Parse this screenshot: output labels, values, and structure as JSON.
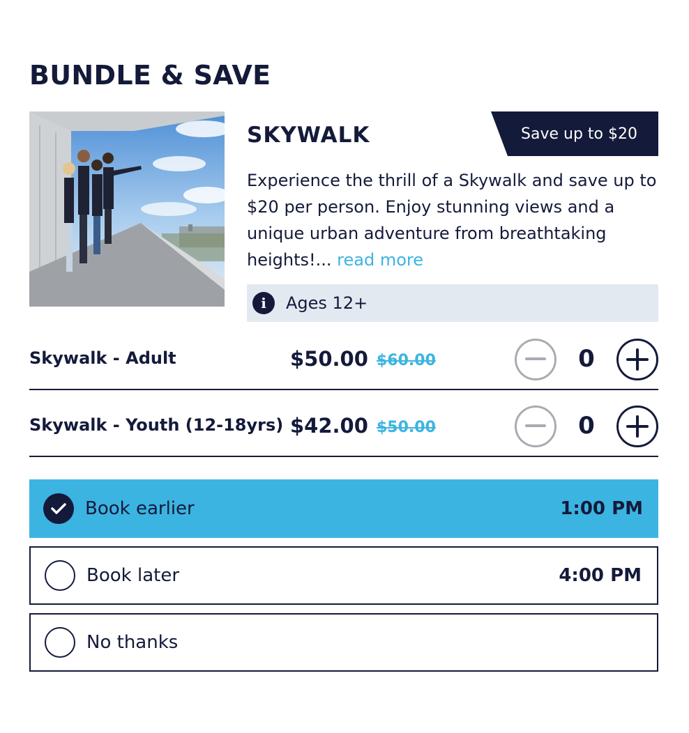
{
  "bundle": {
    "title": "BUNDLE & SAVE",
    "product_name": "SKYWALK",
    "save_badge": "Save up to $20",
    "description": "Experience the thrill of a Skywalk and save up to $20 per person. Enjoy stunning views and a unique urban adventure from breathtaking heights!...",
    "read_more": "read more",
    "ages": "Ages 12+",
    "icons": {
      "info": "info-icon",
      "minus": "minus-icon",
      "plus": "plus-icon",
      "check": "check-icon"
    }
  },
  "tickets": [
    {
      "label": "Skywalk - Adult",
      "price": "$50.00",
      "old_price": "$60.00",
      "quantity": "0"
    },
    {
      "label": "Skywalk - Youth (12-18yrs)",
      "price": "$42.00",
      "old_price": "$50.00",
      "quantity": "0"
    }
  ],
  "options": [
    {
      "label": "Book earlier",
      "time": "1:00 PM",
      "selected": true
    },
    {
      "label": "Book later",
      "time": "4:00 PM",
      "selected": false
    },
    {
      "label": "No thanks",
      "time": "",
      "selected": false
    }
  ],
  "colors": {
    "navy": "#141a3a",
    "accent": "#3cb4e1",
    "info_bg": "#e3e9f0",
    "disabled": "#a9abb2"
  }
}
